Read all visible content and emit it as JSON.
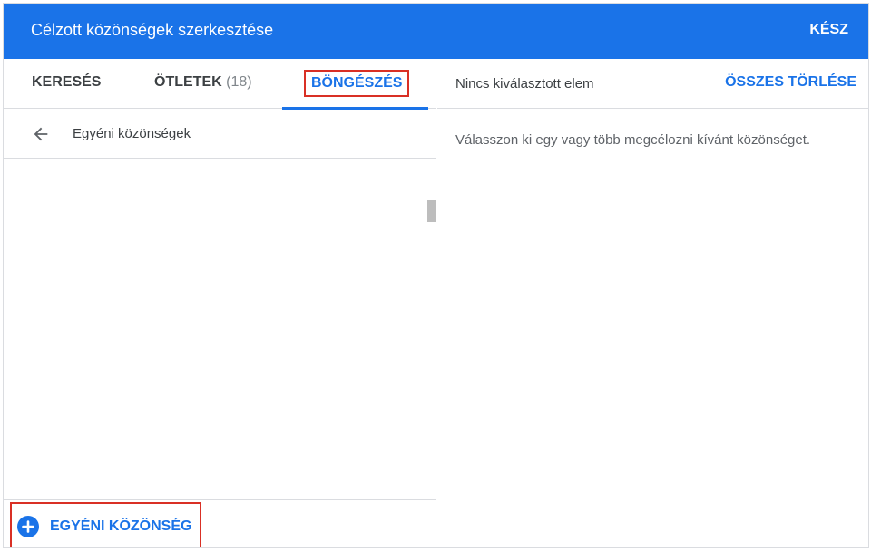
{
  "header": {
    "title": "Célzott közönségek szerkesztése",
    "done_label": "KÉSZ"
  },
  "tabs": [
    {
      "label": "KERESÉS",
      "count": ""
    },
    {
      "label": "ÖTLETEK",
      "count": "(18)"
    },
    {
      "label": "BÖNGÉSZÉS",
      "count": ""
    }
  ],
  "active_tab": "BÖNGÉSZÉS",
  "browse": {
    "back_icon": "arrow-left-icon",
    "category_label": "Egyéni közönségek"
  },
  "footer": {
    "add_icon": "plus-circle-icon",
    "add_label": "EGYÉNI KÖZÖNSÉG"
  },
  "selection": {
    "status": "Nincs kiválasztott elem",
    "clear_label": "ÖSSZES TÖRLÉSE",
    "hint": "Válasszon ki egy vagy több megcélozni kívánt közönséget."
  },
  "colors": {
    "primary": "#1a73e8",
    "highlight_border": "#d93025",
    "divider": "#dadce0"
  }
}
